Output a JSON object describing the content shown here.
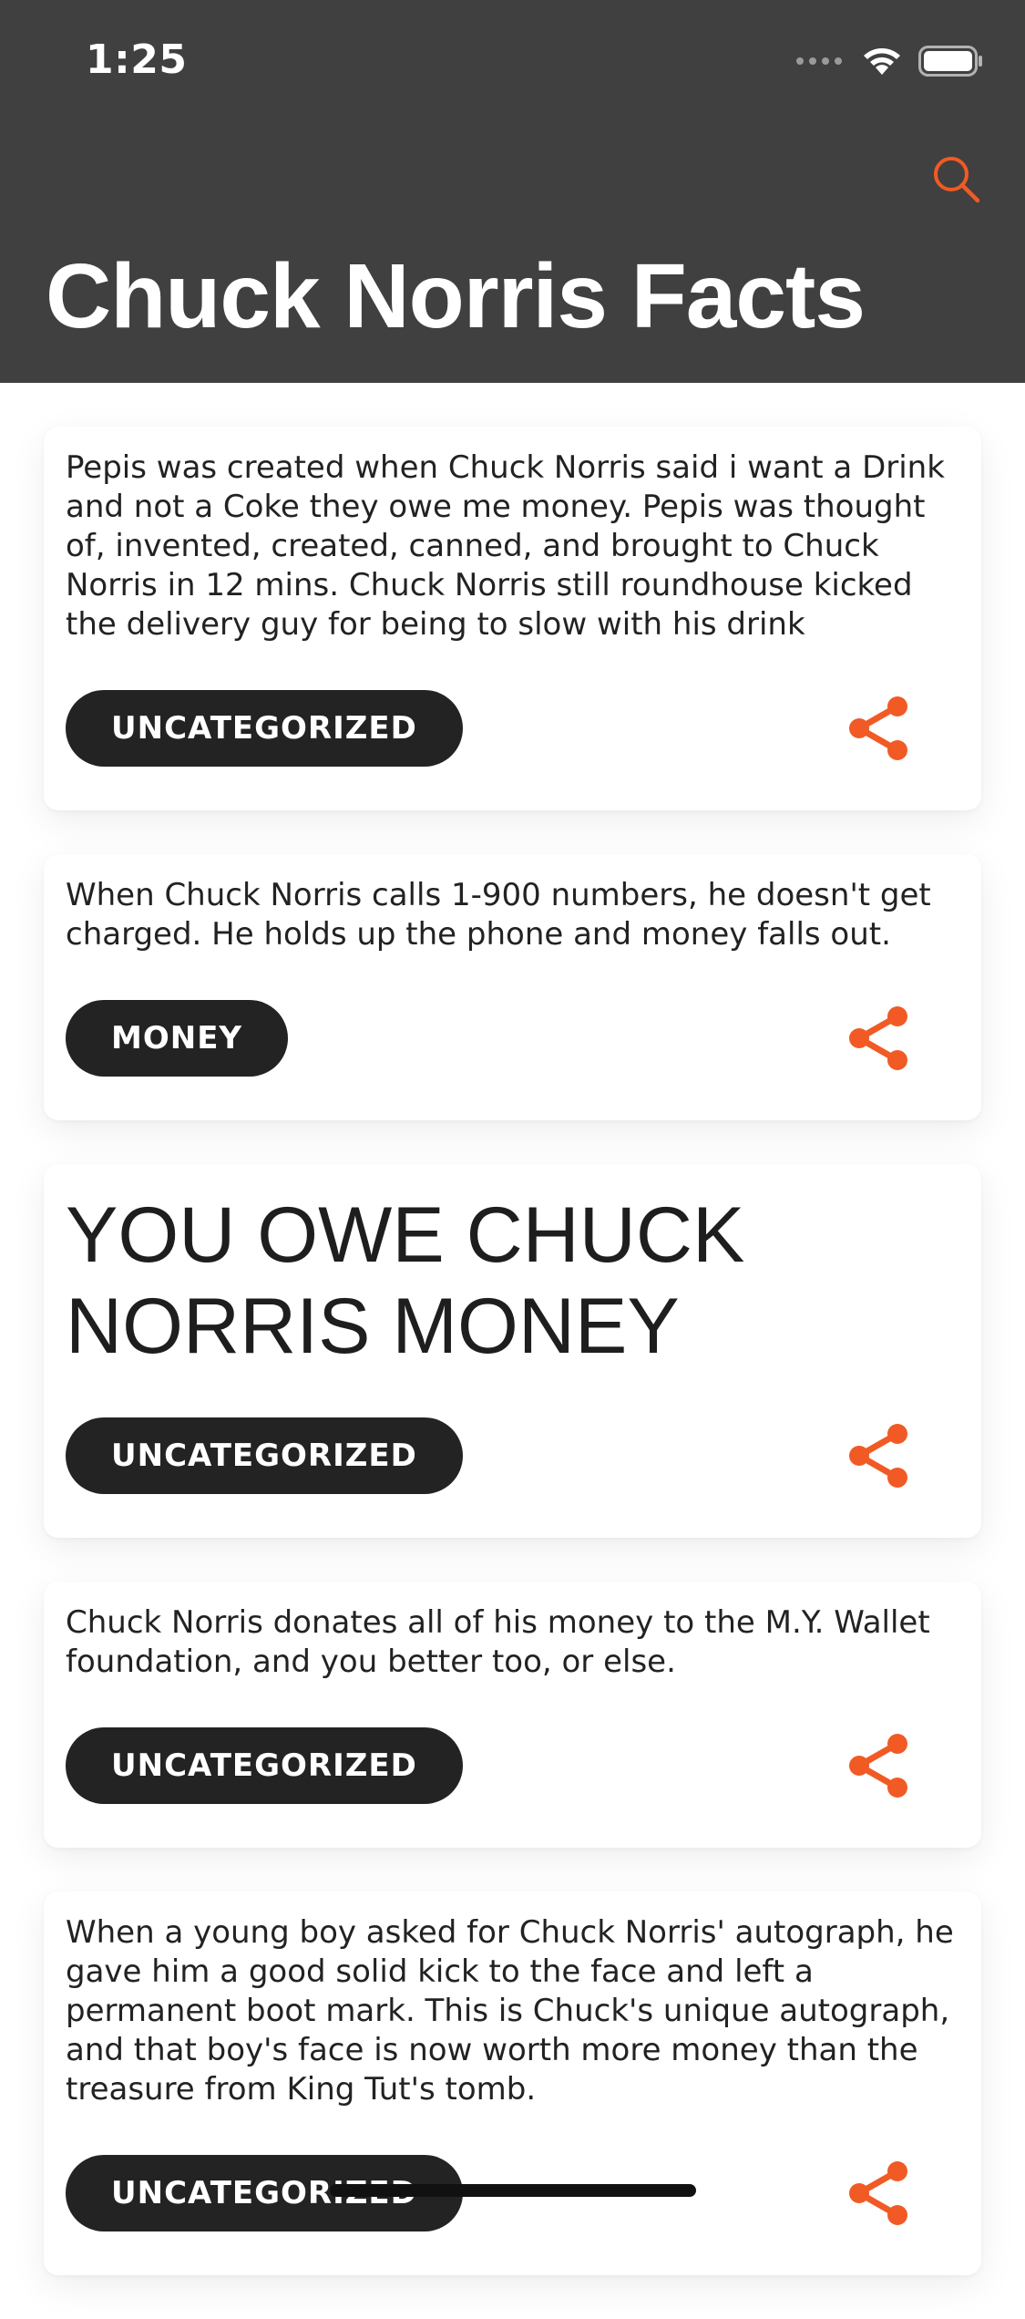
{
  "status_bar": {
    "time": "1:25"
  },
  "header": {
    "title": "Chuck Norris Facts",
    "search_icon": "search-icon"
  },
  "colors": {
    "header_bg": "#404040",
    "accent": "#F15A24",
    "tag_bg": "#232323"
  },
  "facts": [
    {
      "text": "Pepis was created when Chuck Norris said i want a Drink and not a Coke they owe me money. Pepis was thought of, invented, created, canned, and brought to Chuck Norris in 12 mins. Chuck Norris still roundhouse kicked the delivery guy for being to slow with his drink",
      "category": "UNCATEGORIZED"
    },
    {
      "text": "When Chuck Norris calls 1-900 numbers, he doesn't get charged. He holds up the phone and money falls out.",
      "category": "MONEY"
    },
    {
      "text": "YOU OWE CHUCK NORRIS MONEY",
      "category": "UNCATEGORIZED"
    },
    {
      "text": "Chuck Norris donates all of his money to the M.Y. Wallet foundation, and you better too, or else.",
      "category": "UNCATEGORIZED"
    },
    {
      "text": "When a young boy asked for Chuck Norris' autograph, he gave him a good solid kick to the face and left a permanent boot mark. This is Chuck's unique autograph, and that boy's face is now worth more money than the treasure from King Tut's tomb.",
      "category": "UNCATEGORIZED"
    }
  ]
}
